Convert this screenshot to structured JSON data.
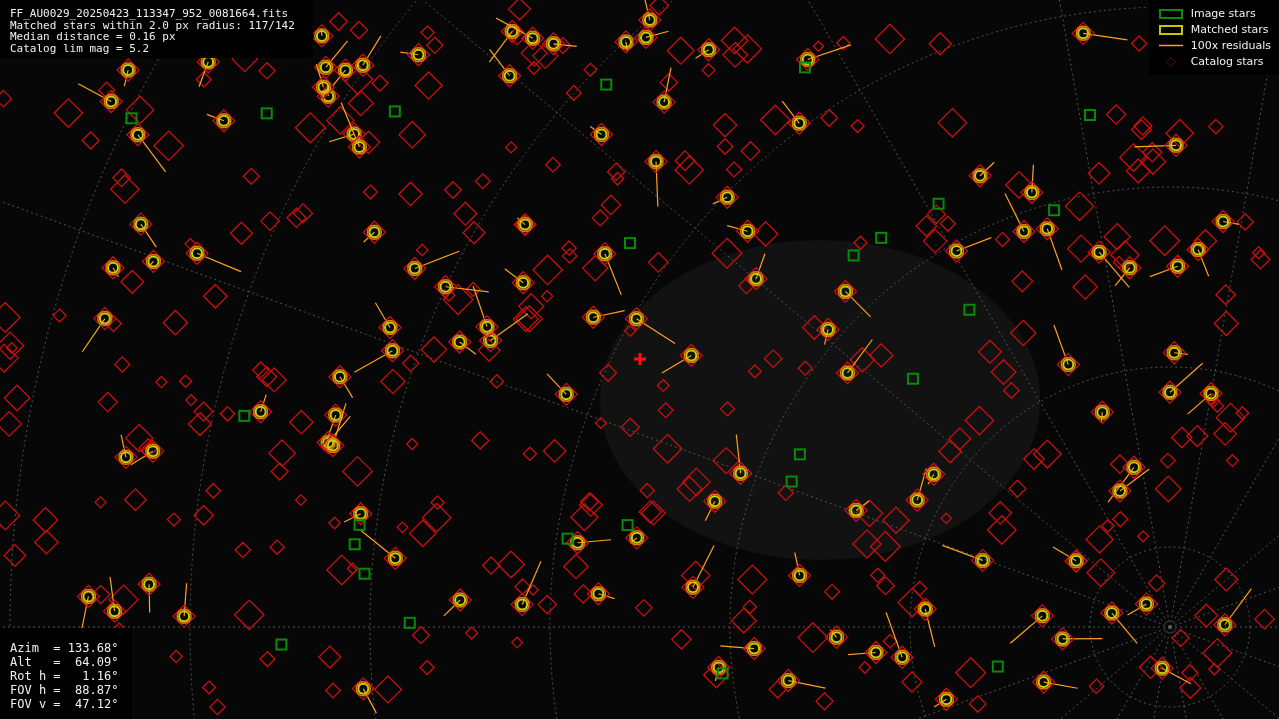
{
  "info": {
    "lines": [
      "FF_AU0029_20250423_113347_952_0081664.fits",
      "Matched stars within 2.0 px radius: 117/142",
      "Median distance = 0.16 px",
      "Catalog lim mag = 5.2"
    ]
  },
  "legend": [
    {
      "kind": "image",
      "label": "Image stars"
    },
    {
      "kind": "matched",
      "label": "Matched stars"
    },
    {
      "kind": "residual",
      "label": "100x residuals"
    },
    {
      "kind": "catalog",
      "label": "Catalog stars"
    }
  ],
  "pointing": {
    "lines": [
      "Azim  = 133.68°",
      "Alt   =  64.09°",
      "Rot h =   1.16°",
      "FOV h =  88.87°",
      "FOV v =  47.12°"
    ]
  }
}
